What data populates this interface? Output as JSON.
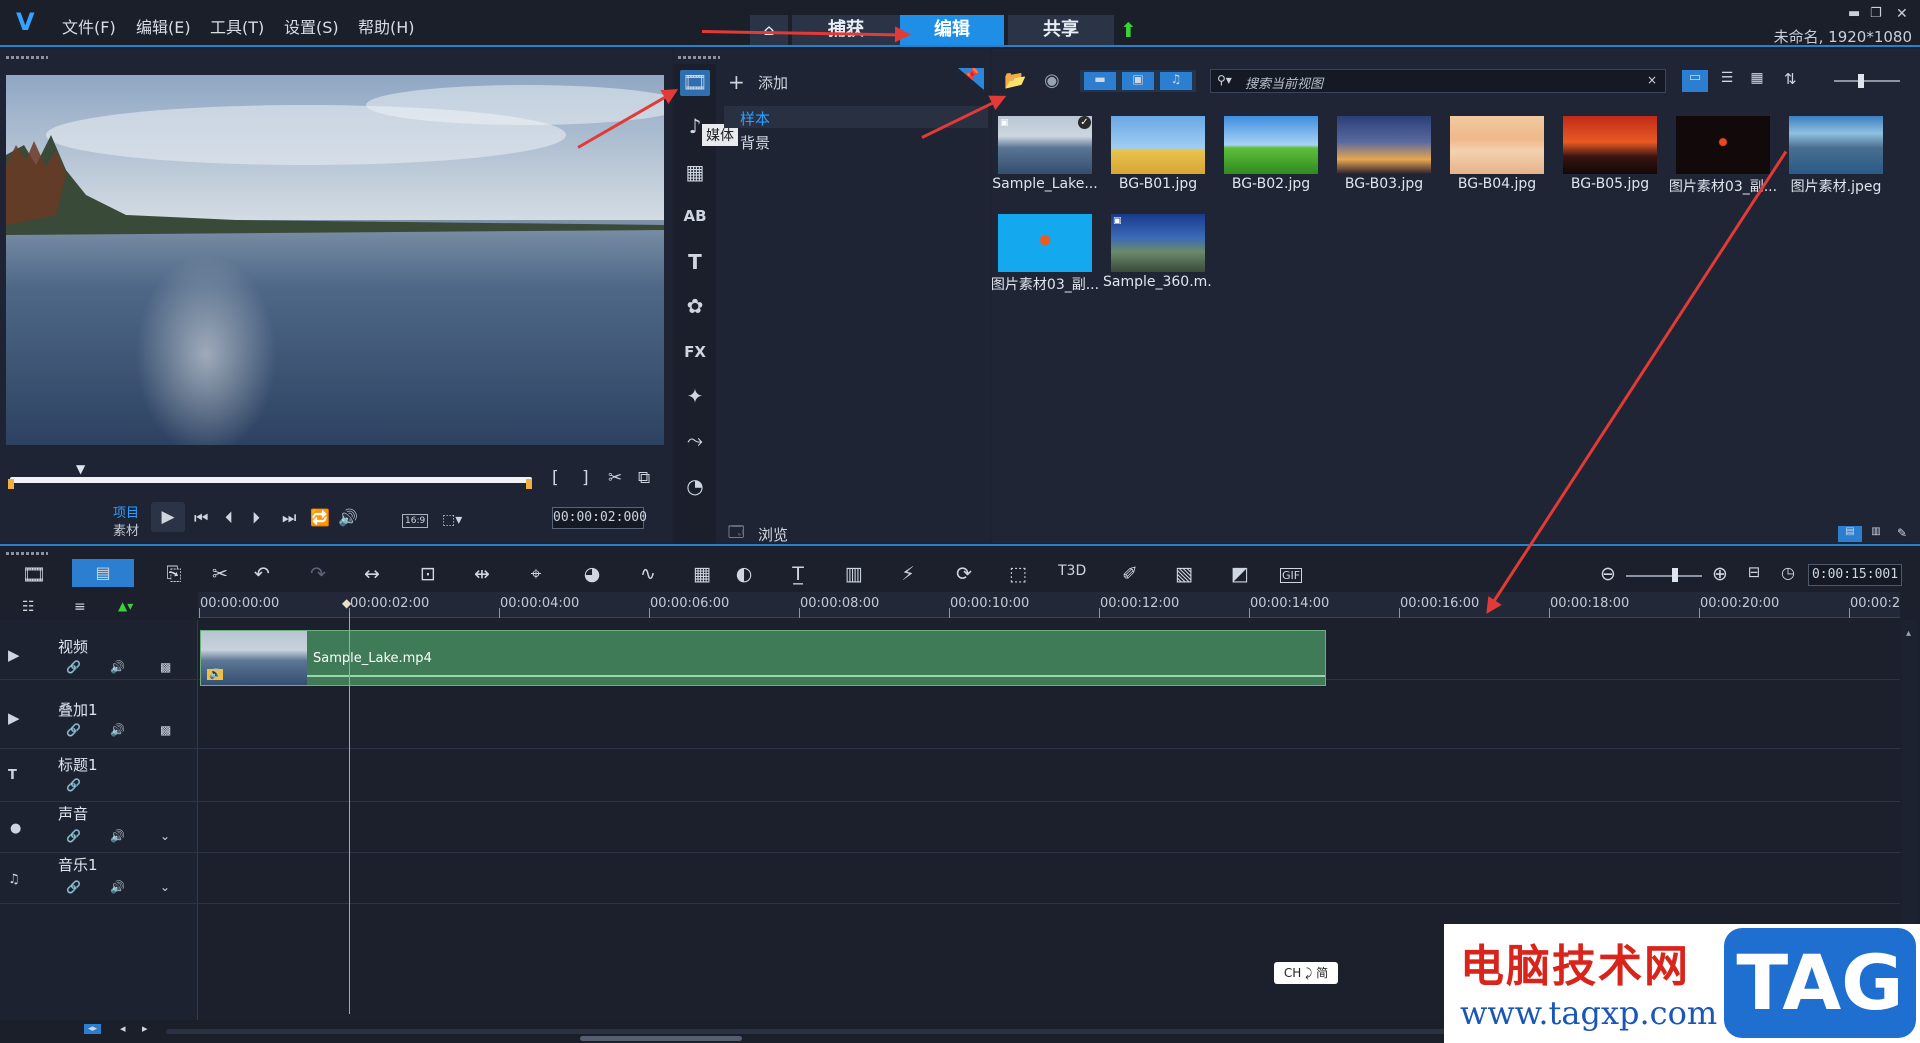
{
  "menu": {
    "file": "文件(F)",
    "edit": "编辑(E)",
    "tools": "工具(T)",
    "settings": "设置(S)",
    "help": "帮助(H)"
  },
  "tabs": {
    "capture": "捕获",
    "edit": "编辑",
    "share": "共享"
  },
  "status": {
    "project_info": "未命名, 1920*1080"
  },
  "library": {
    "add_label": "添加",
    "folders": [
      "样本",
      "背景"
    ],
    "media_tooltip": "媒体",
    "browse_label": "浏览",
    "search_placeholder": "搜索当前视图",
    "items": [
      {
        "label": "Sample_Lake...",
        "img": "lake",
        "video": true,
        "checked": true
      },
      {
        "label": "BG-B01.jpg",
        "img": "b01"
      },
      {
        "label": "BG-B02.jpg",
        "img": "b02"
      },
      {
        "label": "BG-B03.jpg",
        "img": "b03"
      },
      {
        "label": "BG-B04.jpg",
        "img": "b04"
      },
      {
        "label": "BG-B05.jpg",
        "img": "b05"
      },
      {
        "label": "图片素材03_副...",
        "img": "office_dark"
      },
      {
        "label": "图片素材.jpeg",
        "img": "mountain"
      },
      {
        "label": "图片素材03_副...",
        "img": "office_blue"
      },
      {
        "label": "Sample_360.m...",
        "img": "pano",
        "video": true
      }
    ]
  },
  "player": {
    "mode_project": "项目",
    "mode_clip": "素材",
    "timecode": "00:00:02:000",
    "aspect": "16:9"
  },
  "timeline": {
    "zoom_timecode": "0:00:15:001",
    "ruler": [
      "00:00:00:00",
      "00:00:02:00",
      "00:00:04:00",
      "00:00:06:00",
      "00:00:08:00",
      "00:00:10:00",
      "00:00:12:00",
      "00:00:14:00",
      "00:00:16:00",
      "00:00:18:00",
      "00:00:20:00",
      "00:00:2"
    ],
    "tracks": [
      "视频",
      "叠加1",
      "标题1",
      "声音",
      "音乐1"
    ],
    "clip_name": "Sample_Lake.mp4"
  },
  "ime": "CH ⤸ 简",
  "watermark": {
    "title": "电脑技术网",
    "url": "www.tagxp.com",
    "tag": "TAG"
  }
}
